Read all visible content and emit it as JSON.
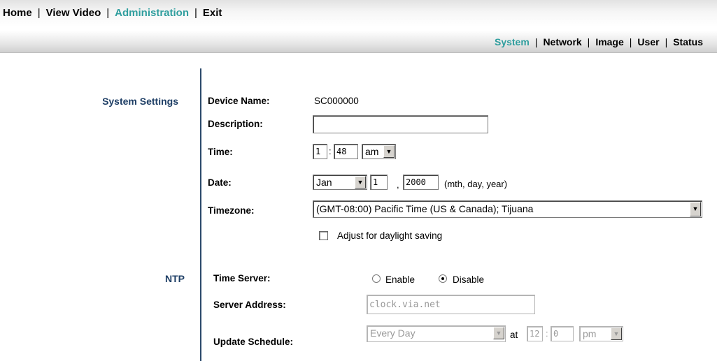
{
  "top_nav": {
    "home": "Home",
    "view_video": "View Video",
    "administration": "Administration",
    "exit": "Exit",
    "separator": "|"
  },
  "sub_nav": {
    "system": "System",
    "network": "Network",
    "image": "Image",
    "user": "User",
    "status": "Status",
    "separator": "|"
  },
  "colors": {
    "active_tab": "#2f9e9e",
    "section_title": "#1f3f66"
  },
  "system_settings": {
    "title": "System Settings",
    "device_name_label": "Device Name:",
    "device_name_value": "SC000000",
    "description_label": "Description:",
    "description_value": "",
    "time_label": "Time:",
    "time_hour": "1",
    "time_sep": ":",
    "time_minute": "48",
    "time_ampm": "am",
    "date_label": "Date:",
    "date_month": "Jan",
    "date_day": "1",
    "date_sep": ",",
    "date_year": "2000",
    "date_hint": "(mth, day, year)",
    "timezone_label": "Timezone:",
    "timezone_value": "(GMT-08:00) Pacific Time (US & Canada); Tijuana",
    "dst_label": "Adjust for daylight saving",
    "dst_checked": false
  },
  "ntp": {
    "title": "NTP",
    "time_server_label": "Time Server:",
    "enable_label": "Enable",
    "disable_label": "Disable",
    "selected": "Disable",
    "server_address_label": "Server Address:",
    "server_address_value": "clock.via.net",
    "update_schedule_label": "Update Schedule:",
    "schedule_value": "Every Day",
    "at_label": "at",
    "schedule_hour": "12",
    "schedule_sep": ":",
    "schedule_minute": "0",
    "schedule_ampm": "pm"
  }
}
